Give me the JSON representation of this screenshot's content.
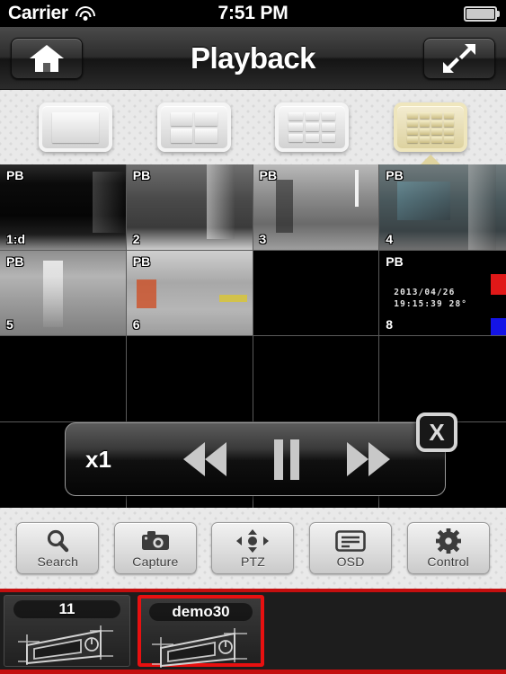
{
  "status_bar": {
    "carrier": "Carrier",
    "wifi_icon": "wifi-icon",
    "time": "7:51 PM",
    "battery_icon": "battery-icon"
  },
  "nav_bar": {
    "title": "Playback",
    "home_icon": "home-icon",
    "expand_icon": "expand-diagonal-icon"
  },
  "layout_selector": {
    "options": [
      {
        "label": "1",
        "cols": 1,
        "selected": false,
        "icon": "layout-1x1-icon"
      },
      {
        "label": "4",
        "cols": 2,
        "selected": false,
        "icon": "layout-2x2-icon"
      },
      {
        "label": "9",
        "cols": 3,
        "selected": false,
        "icon": "layout-3x3-icon"
      },
      {
        "label": "16",
        "cols": 4,
        "selected": true,
        "icon": "layout-4x4-icon"
      }
    ],
    "selected_index": 3,
    "highlight_color": "#ddd2a0"
  },
  "video_grid": {
    "rows": 4,
    "cols": 4,
    "cells": [
      {
        "pb": "PB",
        "channel": "1:d",
        "has_video": true
      },
      {
        "pb": "PB",
        "channel": "2",
        "has_video": true
      },
      {
        "pb": "PB",
        "channel": "3",
        "has_video": true
      },
      {
        "pb": "PB",
        "channel": "4",
        "has_video": true
      },
      {
        "pb": "PB",
        "channel": "5",
        "has_video": true
      },
      {
        "pb": "PB",
        "channel": "6",
        "has_video": true
      },
      {
        "pb": "",
        "channel": "",
        "has_video": false
      },
      {
        "pb": "PB",
        "channel": "8",
        "has_video": false,
        "osd_date": "2013/04/26",
        "osd_time": "19:15:39  28°",
        "color_bars": [
          "#e01818",
          "#1414e6"
        ]
      },
      {
        "pb": "",
        "channel": "",
        "has_video": false
      },
      {
        "pb": "",
        "channel": "",
        "has_video": false
      },
      {
        "pb": "",
        "channel": "",
        "has_video": false
      },
      {
        "pb": "",
        "channel": "",
        "has_video": false
      },
      {
        "pb": "",
        "channel": "",
        "has_video": false
      },
      {
        "pb": "",
        "channel": "",
        "has_video": false
      },
      {
        "pb": "",
        "channel": "",
        "has_video": false
      },
      {
        "pb": "",
        "channel": "",
        "has_video": false
      }
    ]
  },
  "playback_controls": {
    "speed": "x1",
    "rewind_icon": "rewind-icon",
    "pause_icon": "pause-icon",
    "forward_icon": "fast-forward-icon",
    "close_label": "X"
  },
  "function_bar": {
    "buttons": [
      {
        "label": "Search",
        "icon": "magnifier-icon"
      },
      {
        "label": "Capture",
        "icon": "camera-icon"
      },
      {
        "label": "PTZ",
        "icon": "dpad-icon"
      },
      {
        "label": "OSD",
        "icon": "display-icon"
      },
      {
        "label": "Control",
        "icon": "gear-icon"
      }
    ]
  },
  "device_bar": {
    "accent_color": "#c40f0f",
    "devices": [
      {
        "name": "11",
        "selected": false,
        "icon": "dvr-icon"
      },
      {
        "name": "demo30",
        "selected": true,
        "icon": "dvr-icon"
      }
    ]
  }
}
